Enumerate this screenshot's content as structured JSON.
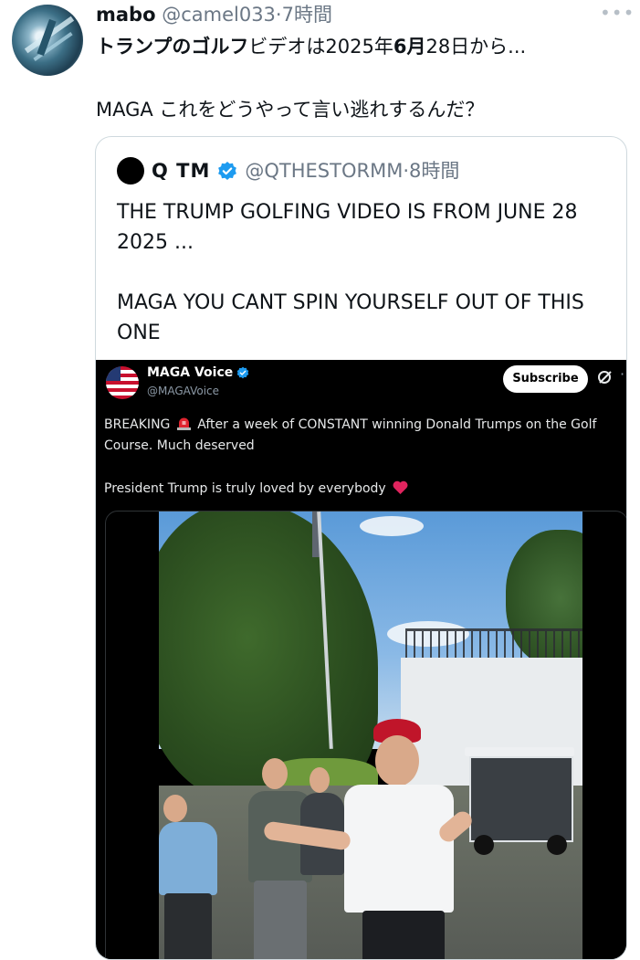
{
  "tweet": {
    "author_name": "mabo",
    "author_handle": "@camel033",
    "separator": "·",
    "time": "7時間",
    "more_label": "•••",
    "text_line1": [
      {
        "t": "トランプの",
        "b": true
      },
      {
        "t": "ゴルフ",
        "b": true
      },
      {
        "t": "ビデオは2025年",
        "b": false
      },
      {
        "t": "6月",
        "b": true
      },
      {
        "t": "28日から...",
        "b": false
      }
    ],
    "text_line2": "MAGA これをどうやって言い逃れするんだ？"
  },
  "quoted": {
    "author_name": "Q TM",
    "author_handle": "@QTHESTORMM",
    "separator": "·",
    "time": "8時間",
    "paragraphs": [
      "THE TRUMP GOLFING VIDEO IS FROM JUNE 28 2025 ...",
      "MAGA YOU CANT SPIN YOURSELF OUT OF THIS ONE"
    ],
    "media": {
      "account_name": "MAGA Voice",
      "account_handle": "@MAGAVoice",
      "subscribe_label": "Subscribe",
      "line1_prefix": "BREAKING",
      "line1_suffix": "After a week of CONSTANT winning Donald Trumps on the Golf Course. Much deserved",
      "line2": "President Trump is truly loved by everybody"
    }
  },
  "colors": {
    "verified": "#1d9bf0",
    "secondary_text": "#6b7785",
    "border": "#cfd9de",
    "cap_red": "#c0152a"
  },
  "icons": [
    "more-icon",
    "verified-badge-icon",
    "siren-icon",
    "heart-icon",
    "grok-icon"
  ]
}
